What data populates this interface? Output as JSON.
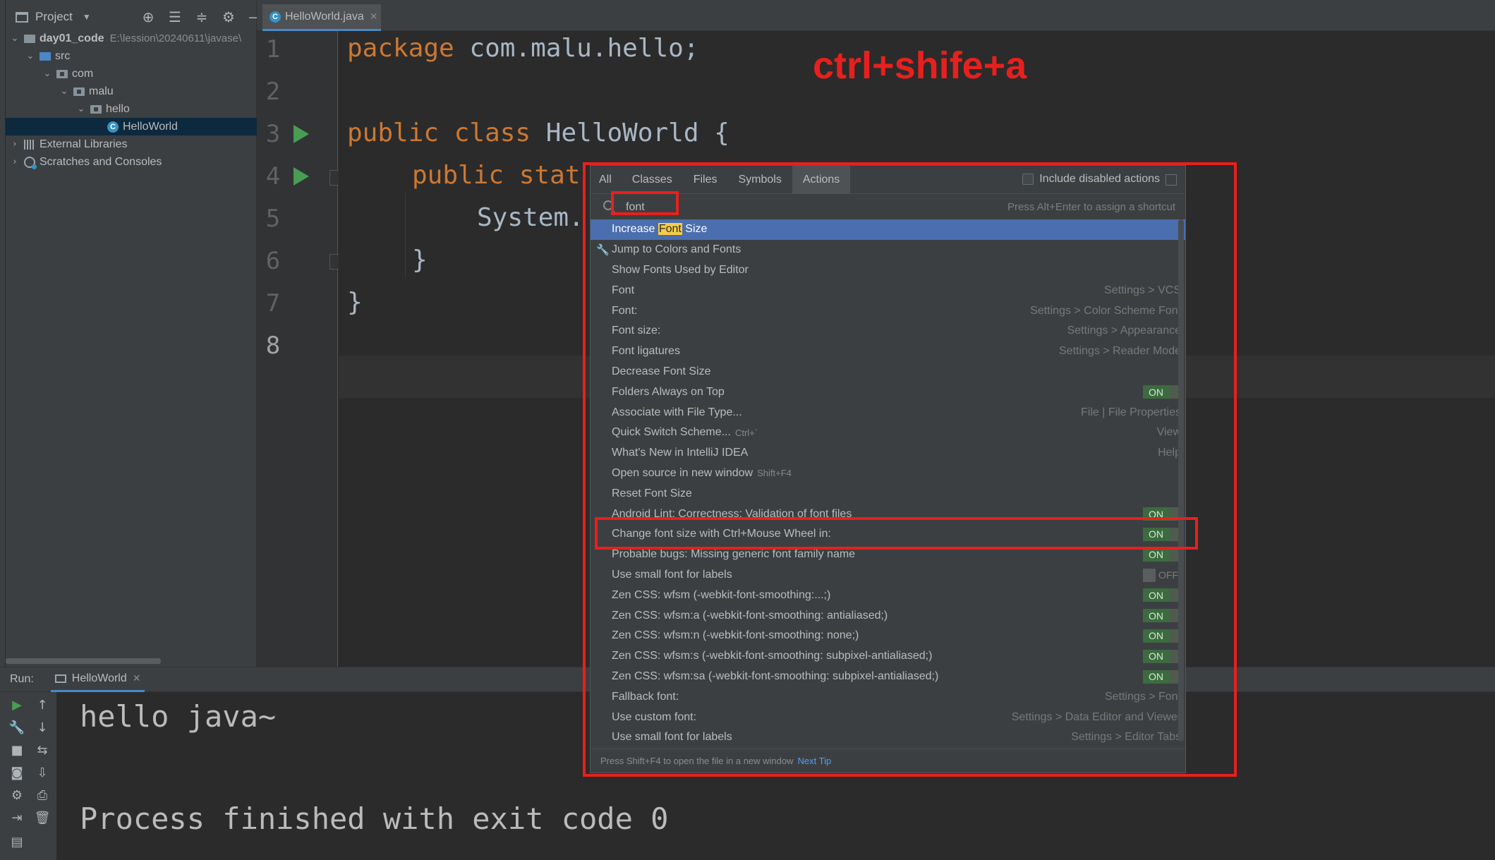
{
  "project": {
    "title": "Project",
    "tree": [
      {
        "label": "day01_code",
        "hint": "E:\\lession\\20240611\\javase\\"
      },
      {
        "label": "src"
      },
      {
        "label": "com"
      },
      {
        "label": "malu"
      },
      {
        "label": "hello"
      },
      {
        "label": "HelloWorld"
      },
      {
        "label": "External Libraries"
      },
      {
        "label": "Scratches and Consoles"
      }
    ]
  },
  "editor": {
    "tab_label": "HelloWorld.java",
    "line_numbers": [
      "1",
      "2",
      "3",
      "4",
      "5",
      "6",
      "7",
      "8"
    ],
    "lines": {
      "l1_kw": "package",
      "l1_rest": " com.malu.hello;",
      "l3_kw": "public class",
      "l3_rest": " HelloWorld {",
      "l4_kw": "public stat",
      "l5": "System.",
      "l6": "}",
      "l7": "}"
    }
  },
  "annotation_text": "ctrl+shife+a",
  "popup": {
    "tabs": [
      "All",
      "Classes",
      "Files",
      "Symbols",
      "Actions"
    ],
    "active_tab": "Actions",
    "include_disabled_label": "Include disabled actions",
    "search_value": "font",
    "shortcut_hint": "Press Alt+Enter to assign a shortcut",
    "results": [
      {
        "pre": "Increase ",
        "hl": "Font",
        "post": " Size"
      },
      {
        "label": "Jump to Colors and Fonts",
        "icon": "wrench-icon"
      },
      {
        "label": "Show Fonts Used by Editor"
      },
      {
        "label": "Font",
        "location": "Settings > VCS"
      },
      {
        "label": "Font:",
        "location": "Settings > Color Scheme Font"
      },
      {
        "label": "Font size:",
        "location": "Settings > Appearance"
      },
      {
        "label": "Font ligatures",
        "location": "Settings > Reader Mode"
      },
      {
        "label": "Decrease Font Size"
      },
      {
        "label": "Folders Always on Top",
        "toggle": "ON"
      },
      {
        "label": "Associate with File Type...",
        "location": "File | File Properties"
      },
      {
        "label": "Quick Switch Scheme...",
        "shortcut": "Ctrl+`",
        "location": "View"
      },
      {
        "label": "What's New in IntelliJ IDEA",
        "location": "Help"
      },
      {
        "label": "Open source in new window",
        "shortcut": "Shift+F4"
      },
      {
        "label": "Reset Font Size"
      },
      {
        "label": "Android Lint: Correctness: Validation of font files",
        "toggle": "ON"
      },
      {
        "label": "Change font size with Ctrl+Mouse Wheel in:",
        "toggle": "ON"
      },
      {
        "label": "Probable bugs: Missing generic font family name",
        "toggle": "ON"
      },
      {
        "label": "Use small font for labels",
        "toggle": "OFF"
      },
      {
        "label": "Zen CSS: wfsm (-webkit-font-smoothing:...;)",
        "toggle": "ON"
      },
      {
        "label": "Zen CSS: wfsm:a (-webkit-font-smoothing: antialiased;)",
        "toggle": "ON"
      },
      {
        "label": "Zen CSS: wfsm:n (-webkit-font-smoothing: none;)",
        "toggle": "ON"
      },
      {
        "label": "Zen CSS: wfsm:s (-webkit-font-smoothing: subpixel-antialiased;)",
        "toggle": "ON"
      },
      {
        "label": "Zen CSS: wfsm:sa (-webkit-font-smoothing: subpixel-antialiased;)",
        "toggle": "ON"
      },
      {
        "label": "Fallback font:",
        "location": "Settings > Font"
      },
      {
        "label": "Use custom font:",
        "location": "Settings > Data Editor and Viewer"
      },
      {
        "label": "Use small font for labels",
        "location": "Settings > Editor Tabs"
      }
    ],
    "footer_text": "Press Shift+F4 to open the file in a new window",
    "footer_link": "Next Tip"
  },
  "run": {
    "label": "Run:",
    "tab_label": "HelloWorld",
    "console_lines": [
      "hello java~",
      "Process finished with exit code 0"
    ]
  },
  "colors": {
    "annotation_red": "#e8201d",
    "selection_blue": "#4b6eaf",
    "keyword_orange": "#cc7832",
    "run_green": "#499c54",
    "match_highlight": "#f5cd47"
  }
}
